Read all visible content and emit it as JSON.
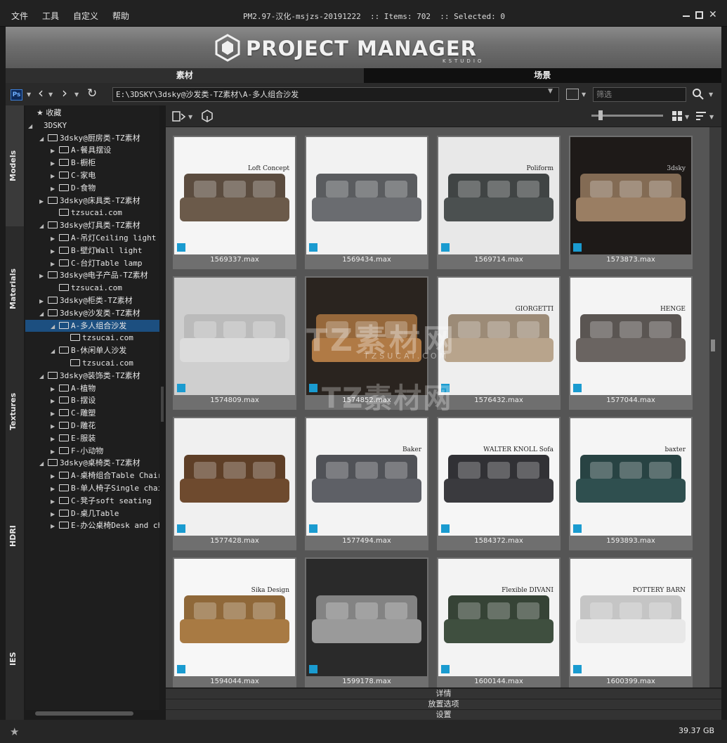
{
  "menu": [
    "文件",
    "工具",
    "自定义",
    "帮助"
  ],
  "window_title": "PM2.97-汉化-msjzs-20191222  :: Items: 702  :: Selected: 0",
  "banner": {
    "title": "PROJECT MANAGER",
    "subtitle": "KSTUDIO"
  },
  "tabs": {
    "models": "素材",
    "scenes": "场景"
  },
  "toolbar": {
    "ps_label": "Ps",
    "path": "E:\\3DSKY\\3dsky@沙发类-TZ素材\\A-多人组合沙发",
    "filter_placeholder": "筛选"
  },
  "side_tabs": [
    "Models",
    "Materials",
    "Textures",
    "HDRI",
    "IES"
  ],
  "tree": [
    {
      "label": "收藏",
      "level": 0,
      "arrow": "",
      "folder": "star"
    },
    {
      "label": "3DSKY",
      "level": 0,
      "arrow": "◢",
      "folder": "none"
    },
    {
      "label": "3dsky@厨房类-TZ素材",
      "level": 1,
      "arrow": "◢",
      "folder": "yes"
    },
    {
      "label": "A-餐具摆设",
      "level": 2,
      "arrow": "▶",
      "folder": "yes"
    },
    {
      "label": "B-橱柜",
      "level": 2,
      "arrow": "▶",
      "folder": "yes"
    },
    {
      "label": "C-家电",
      "level": 2,
      "arrow": "▶",
      "folder": "yes"
    },
    {
      "label": "D-食物",
      "level": 2,
      "arrow": "▶",
      "folder": "yes"
    },
    {
      "label": "3dsky@床具类-TZ素材",
      "level": 1,
      "arrow": "▶",
      "folder": "yes"
    },
    {
      "label": "tzsucai.com",
      "level": 2,
      "arrow": "",
      "folder": "yes"
    },
    {
      "label": "3dsky@灯具类-TZ素材",
      "level": 1,
      "arrow": "◢",
      "folder": "yes"
    },
    {
      "label": "A-吊灯Ceiling light",
      "level": 2,
      "arrow": "▶",
      "folder": "yes"
    },
    {
      "label": "B-壁灯Wall light",
      "level": 2,
      "arrow": "▶",
      "folder": "yes"
    },
    {
      "label": "C-台灯Table lamp",
      "level": 2,
      "arrow": "▶",
      "folder": "yes"
    },
    {
      "label": "3dsky@电子产品-TZ素材",
      "level": 1,
      "arrow": "▶",
      "folder": "yes"
    },
    {
      "label": "tzsucai.com",
      "level": 2,
      "arrow": "",
      "folder": "yes"
    },
    {
      "label": "3dsky@柜类-TZ素材",
      "level": 1,
      "arrow": "▶",
      "folder": "yes"
    },
    {
      "label": "3dsky@沙发类-TZ素材",
      "level": 1,
      "arrow": "◢",
      "folder": "yes"
    },
    {
      "label": "A-多人组合沙发",
      "level": 2,
      "arrow": "◢",
      "folder": "yes",
      "selected": true
    },
    {
      "label": "tzsucai.com",
      "level": 3,
      "arrow": "",
      "folder": "yes"
    },
    {
      "label": "B-休闲单人沙发",
      "level": 2,
      "arrow": "◢",
      "folder": "yes"
    },
    {
      "label": "tzsucai.com",
      "level": 3,
      "arrow": "",
      "folder": "yes"
    },
    {
      "label": "3dsky@装饰类-TZ素材",
      "level": 1,
      "arrow": "◢",
      "folder": "yes"
    },
    {
      "label": "A-植物",
      "level": 2,
      "arrow": "▶",
      "folder": "yes"
    },
    {
      "label": "B-摆设",
      "level": 2,
      "arrow": "▶",
      "folder": "yes"
    },
    {
      "label": "C-雕塑",
      "level": 2,
      "arrow": "▶",
      "folder": "yes"
    },
    {
      "label": "D-雕花",
      "level": 2,
      "arrow": "▶",
      "folder": "yes"
    },
    {
      "label": "E-服装",
      "level": 2,
      "arrow": "▶",
      "folder": "yes"
    },
    {
      "label": "F-小动物",
      "level": 2,
      "arrow": "▶",
      "folder": "yes"
    },
    {
      "label": "3dsky@桌椅类-TZ素材",
      "level": 1,
      "arrow": "◢",
      "folder": "yes"
    },
    {
      "label": "A-桌椅组合Table Chair",
      "level": 2,
      "arrow": "▶",
      "folder": "yes"
    },
    {
      "label": "B-单人椅子Single chair",
      "level": 2,
      "arrow": "▶",
      "folder": "yes"
    },
    {
      "label": "C-凳子soft seating",
      "level": 2,
      "arrow": "▶",
      "folder": "yes"
    },
    {
      "label": "D-桌几Table",
      "level": 2,
      "arrow": "▶",
      "folder": "yes"
    },
    {
      "label": "E-办公桌椅Desk and chair",
      "level": 2,
      "arrow": "▶",
      "folder": "yes"
    }
  ],
  "items": [
    {
      "file": "1569337.max",
      "brand": "Loft Concept",
      "color": "#6b5a4a",
      "bg": "#f5f5f5"
    },
    {
      "file": "1569434.max",
      "brand": "",
      "color": "#6a6c70",
      "bg": "#f2f2f2"
    },
    {
      "file": "1569714.max",
      "brand": "Poliform",
      "color": "#4b5050",
      "bg": "#e8e8e8"
    },
    {
      "file": "1573873.max",
      "brand": "3dsky",
      "color": "#9a7e63",
      "bg": "#1e1a18"
    },
    {
      "file": "1574809.max",
      "brand": "",
      "color": "#dcdcdc",
      "bg": "#cfcfcf"
    },
    {
      "file": "1574852.max",
      "brand": "",
      "color": "#b07a45",
      "bg": "#2a241f"
    },
    {
      "file": "1576432.max",
      "brand": "GIORGETTI",
      "color": "#b8a48c",
      "bg": "#eeeeee"
    },
    {
      "file": "1577044.max",
      "brand": "HENGE",
      "color": "#6a6461",
      "bg": "#f4f4f4"
    },
    {
      "file": "1577428.max",
      "brand": "",
      "color": "#6e4a2e",
      "bg": "#f0f0f0"
    },
    {
      "file": "1577494.max",
      "brand": "Baker",
      "color": "#5e6066",
      "bg": "#f3f3f3"
    },
    {
      "file": "1584372.max",
      "brand": "WALTER KNOLL Sofa",
      "color": "#3a3a3e",
      "bg": "#f6f6f6"
    },
    {
      "file": "1593893.max",
      "brand": "baxter",
      "color": "#2f4f4f",
      "bg": "#f5f5f5"
    },
    {
      "file": "1594044.max",
      "brand": "Sika Design",
      "color": "#a87a43",
      "bg": "#f7f7f7"
    },
    {
      "file": "1599178.max",
      "brand": "",
      "color": "#9a9a9a",
      "bg": "#2a2a2a"
    },
    {
      "file": "1600144.max",
      "brand": "Flexible DIVANI",
      "color": "#3f4f3f",
      "bg": "#f3f3f3"
    },
    {
      "file": "1600399.max",
      "brand": "POTTERY BARN",
      "color": "#e8e8e8",
      "bg": "#f5f5f5"
    }
  ],
  "watermark": {
    "line1": "TZ素材网",
    "url": "TZSUCAI.COM",
    "line2": "TZ素材网"
  },
  "bottom_panels": {
    "details": "详情",
    "placement": "放置选项",
    "settings": "设置"
  },
  "status": {
    "disk_size": "39.37 GB"
  }
}
